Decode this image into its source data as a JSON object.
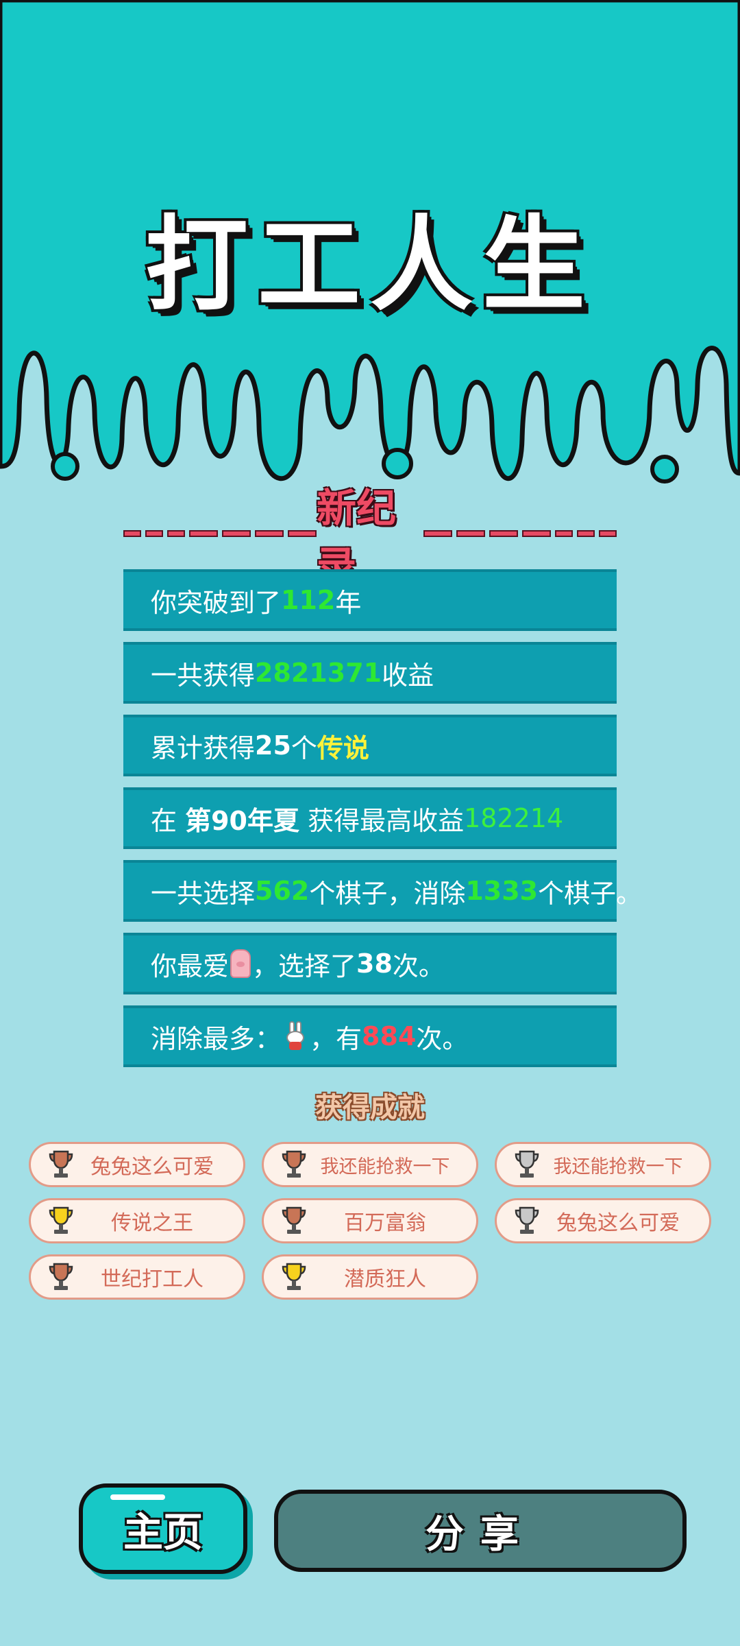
{
  "game": {
    "title": "打工人生"
  },
  "record": {
    "title": "新纪录"
  },
  "stats": {
    "row1": {
      "prefix": "你突破到了",
      "value": "112",
      "suffix": "年"
    },
    "row2": {
      "prefix": "一共获得",
      "value": "2821371",
      "suffix": "收益"
    },
    "row3": {
      "prefix": "累计获得",
      "count": "25",
      "mid": "个",
      "tier": "传说"
    },
    "row4": {
      "prefix": "在 ",
      "season": "第90年夏",
      "mid": " 获得最高收益",
      "value": "182214"
    },
    "row5": {
      "prefix": "一共选择",
      "chosen": "562",
      "mid": "个棋子，消除",
      "eliminated": "1333",
      "suffix": "个棋子。"
    },
    "row6": {
      "prefix": "你最爱",
      "mid": "，选择了",
      "count": "38",
      "suffix": "次。"
    },
    "row7": {
      "prefix": "消除最多：",
      "mid": "，有",
      "count": "884",
      "suffix": "次。"
    }
  },
  "achievements": {
    "title": "获得成就",
    "items": [
      {
        "label": "兔兔这么可爱",
        "trophy": "bronze"
      },
      {
        "label": "我还能抢救一下",
        "trophy": "bronze"
      },
      {
        "label": "我还能抢救一下",
        "trophy": "silver"
      },
      {
        "label": "传说之王",
        "trophy": "gold"
      },
      {
        "label": "百万富翁",
        "trophy": "bronze"
      },
      {
        "label": "兔兔这么可爱",
        "trophy": "silver"
      },
      {
        "label": "世纪打工人",
        "trophy": "bronze"
      },
      {
        "label": "潜质狂人",
        "trophy": "gold"
      }
    ]
  },
  "buttons": {
    "home": "主页",
    "share": "分享"
  },
  "colors": {
    "top_bg": "#17c8c6",
    "page_bg": "#a3dfe6",
    "row_bg": "#0e9fb0",
    "highlight_green": "#2ee832",
    "highlight_yellow": "#fff23a",
    "highlight_red": "#ff4a55",
    "trophy_gold": "#f7d21e",
    "trophy_bronze": "#c87556",
    "trophy_silver": "#c8c8c8"
  }
}
